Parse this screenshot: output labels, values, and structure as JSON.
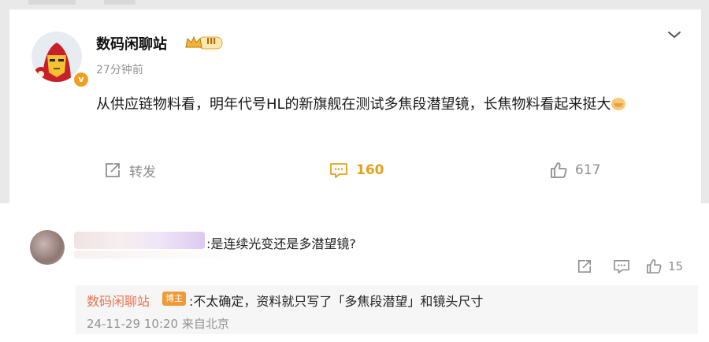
{
  "post": {
    "username": "数码闲聊站",
    "rank_label": "III",
    "avatar_badge": "v",
    "time": "27分钟前",
    "text": "从供应链物料看，明年代号HL的新旗舰在测试多焦段潜望镜，长焦物料看起来挺大",
    "actions": {
      "repost_label": "转发",
      "comment_count": "160",
      "like_count": "617"
    },
    "colors": {
      "accent": "#e3a21a",
      "icon_gray": "#8f8f8f"
    }
  },
  "comment": {
    "text": ":是连续光变还是多潜望镜?",
    "like_count": "15"
  },
  "reply": {
    "username": "数码闲聊站",
    "author_tag": "博主",
    "text": ":不太确定，资料就只写了「多焦段潜望」和镜头尺寸",
    "meta": "24-11-29 10:20 来自北京"
  }
}
